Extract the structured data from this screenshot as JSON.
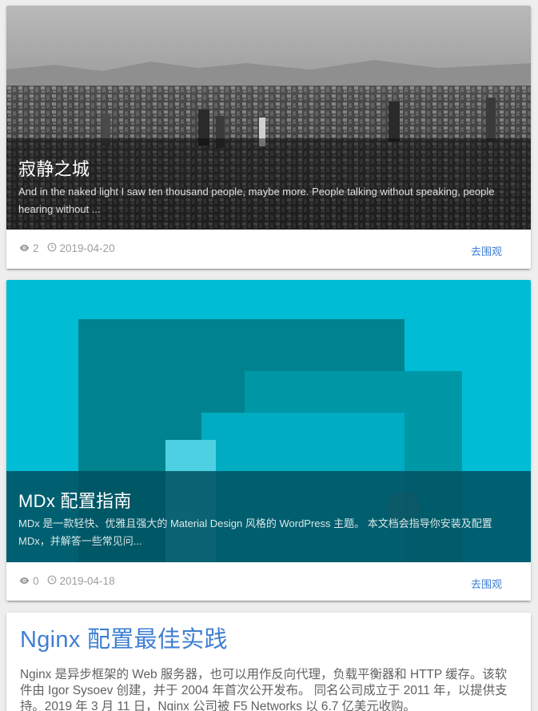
{
  "posts": [
    {
      "title": "寂静之城",
      "excerpt": "And in the naked light I saw ten thousand people, maybe more. People talking without speaking, people hearing without ...",
      "views": "2",
      "date": "2019-04-20",
      "action": "去围观",
      "image": "grayscale-city-aerial"
    },
    {
      "title": "MDx 配置指南",
      "excerpt": "MDx 是一款轻快、优雅且强大的 Material Design 风格的 WordPress 主题。 本文档会指导你安装及配置 MDx，并解答一些常见问...",
      "views": "0",
      "date": "2019-04-18",
      "action": "去围观",
      "image": "cyan-material-shapes"
    },
    {
      "title": "Nginx 配置最佳实践",
      "body": "Nginx 是异步框架的 Web 服务器，也可以用作反向代理，负载平衡器和 HTTP 缓存。该软件由 Igor Sysoev 创建，并于 2004 年首次公开发布。 同名公司成立于 2011 年，以提供支持。2019 年 3 月 11 日，Nginx 公司被 F5 Networks 以 6.7 亿美元收购。"
    }
  ],
  "colors": {
    "accent": "#3f7fd1",
    "cyan": "#00bcd4",
    "meta": "#9e9e9e"
  }
}
